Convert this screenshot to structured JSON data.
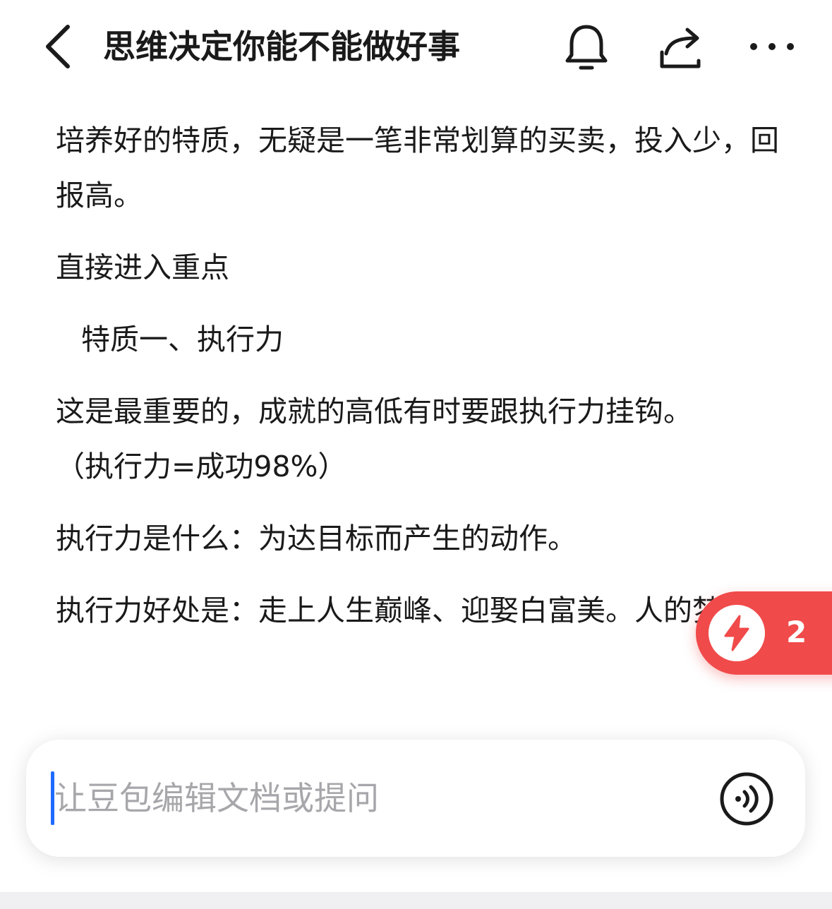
{
  "header": {
    "back_icon": "chevron-left-icon",
    "title": "思维决定你能不能做好事",
    "icons": [
      "bell-icon",
      "share-icon",
      "more-icon"
    ]
  },
  "article": {
    "p1": "培养好的特质，无疑是一笔非常划算的买卖，投入少，回报高。",
    "p2": "直接进入重点",
    "p3": "特质一、执行力",
    "p4_line1": "这是最重要的，成就的高低有时要跟执行力挂钩。",
    "p4_line2": "（执行力=成功98%）",
    "p5": "执行力是什么：为达目标而产生的动作。",
    "p6": "执行力好处是：走上人生巅峰、迎娶白富美。人的梦想）"
  },
  "float_badge": {
    "icon": "lightning-icon",
    "count": "2",
    "color": "#f04a4a"
  },
  "input_bar": {
    "placeholder": "让豆包编辑文档或提问",
    "voice_icon": "voice-icon",
    "caret_color": "#1f6bff"
  }
}
